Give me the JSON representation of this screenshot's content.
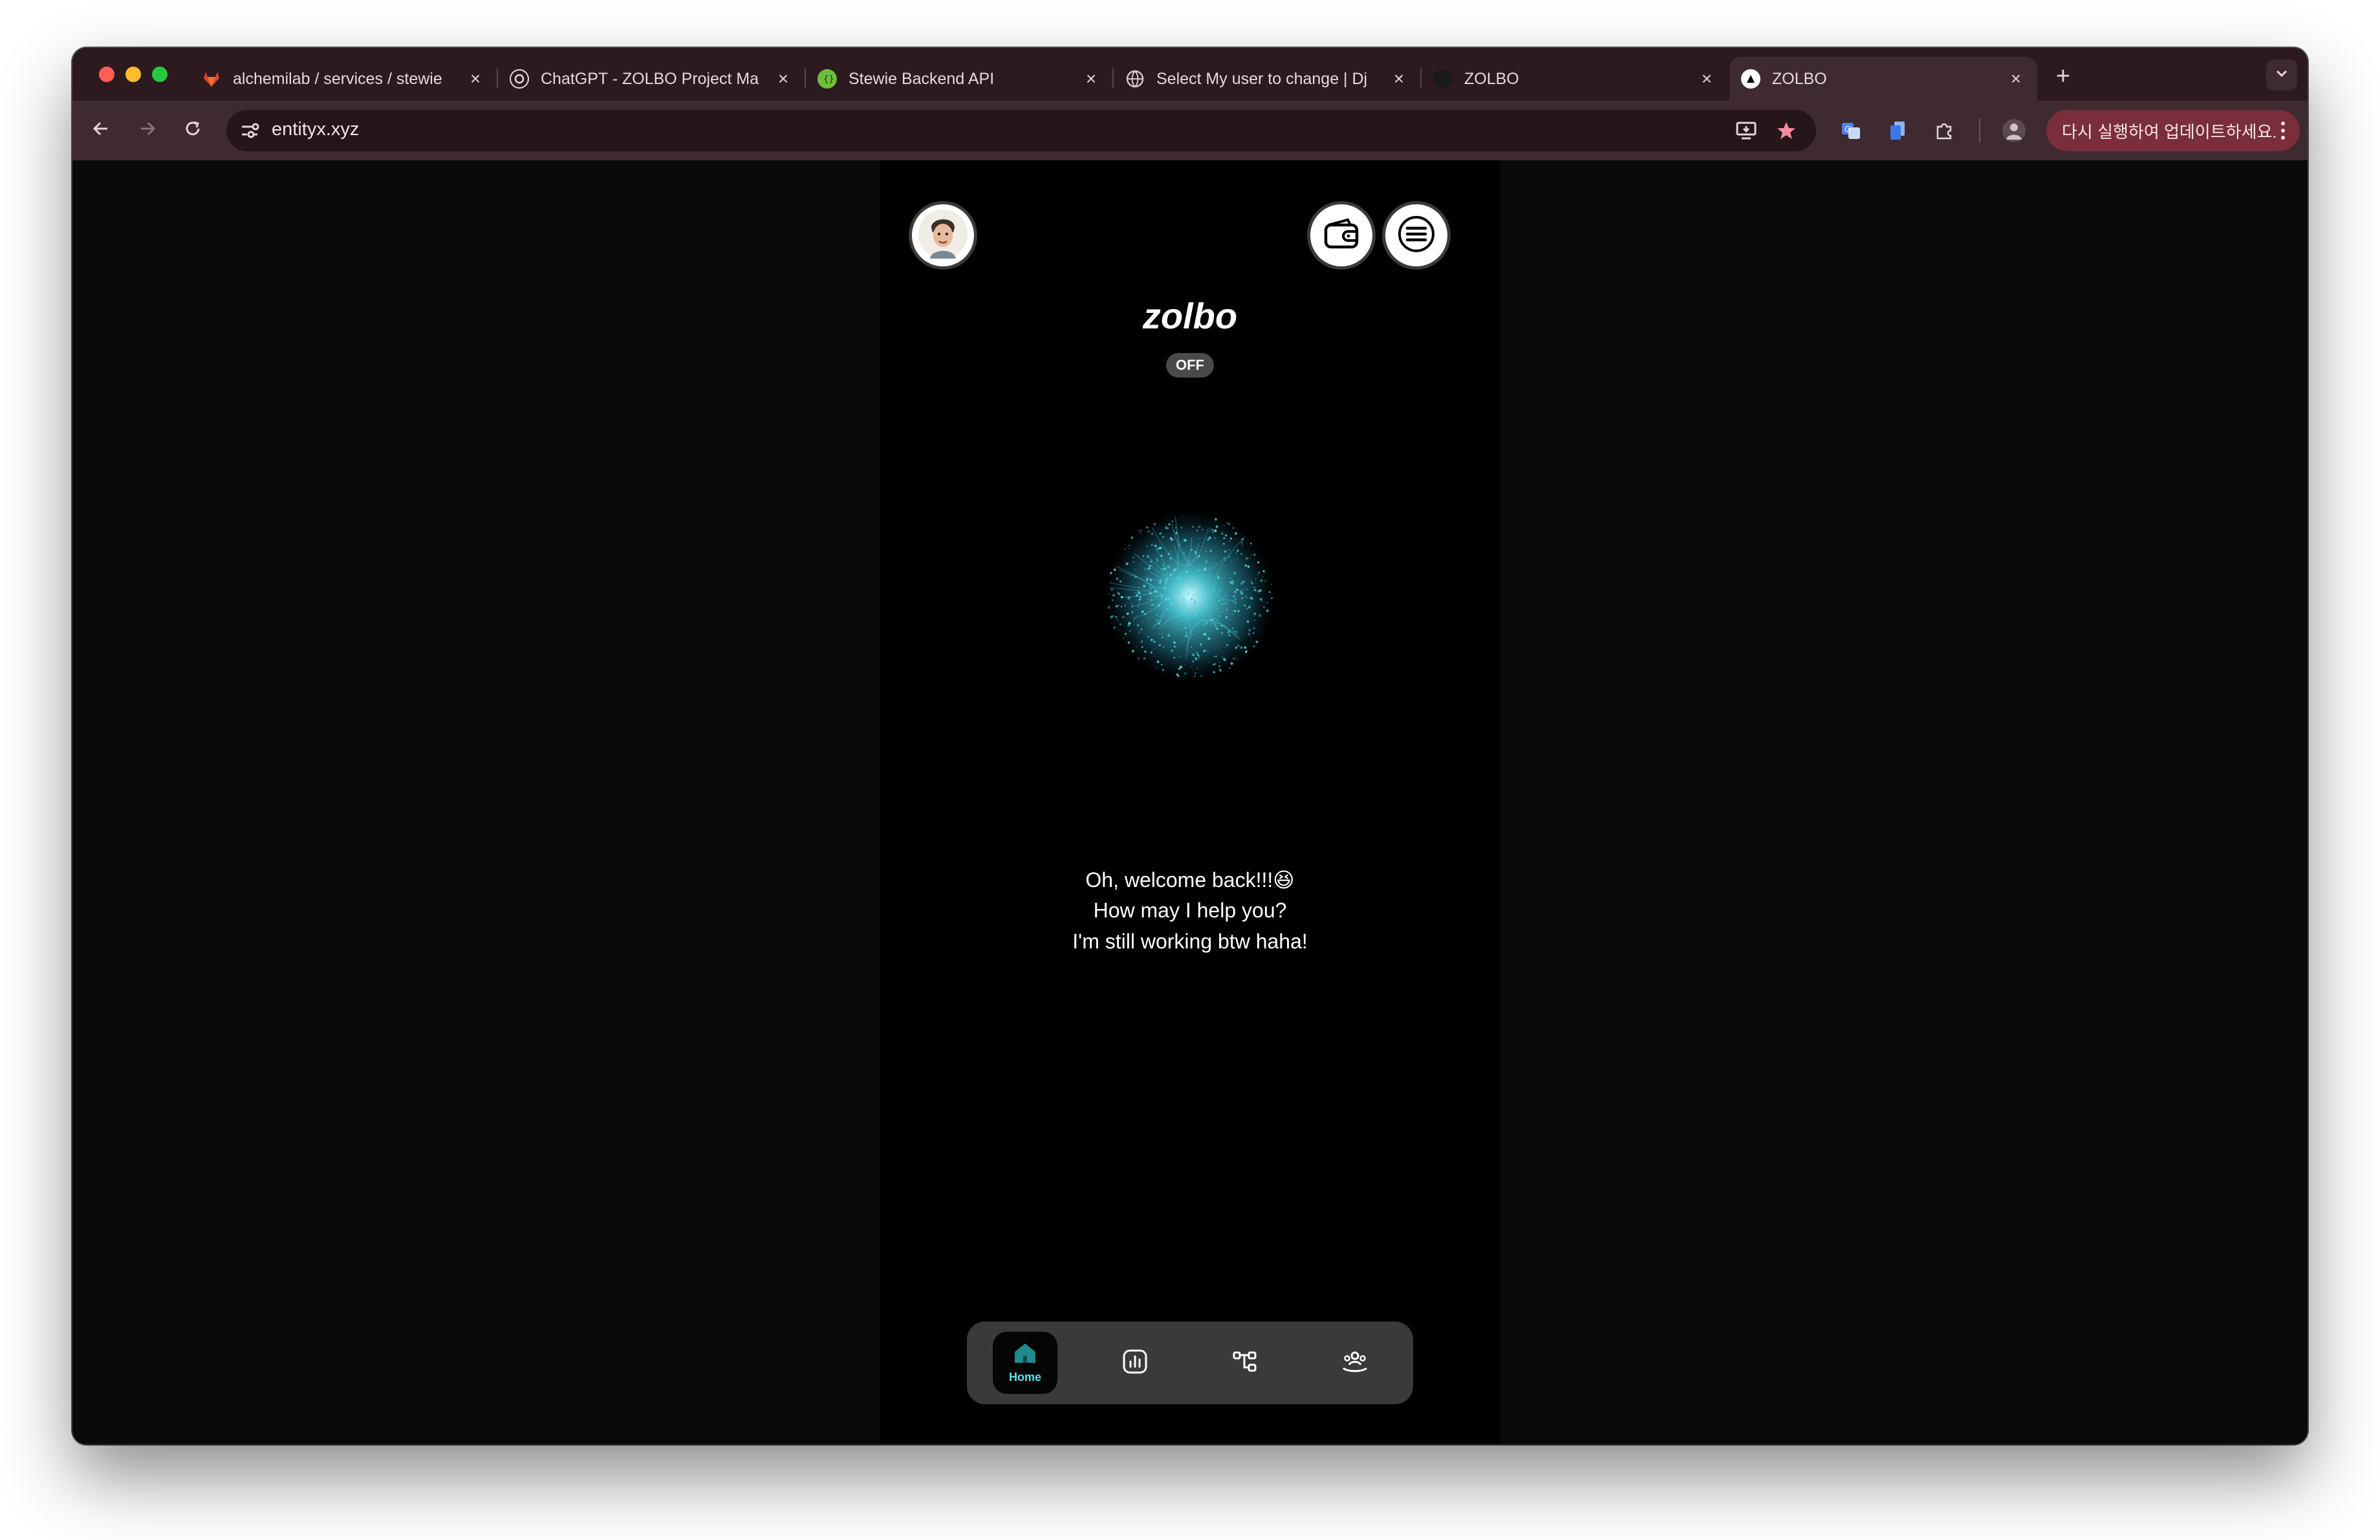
{
  "browser": {
    "tabs": [
      {
        "title": "alchemilab / services / stewie",
        "icon": "gitlab-icon",
        "active": false
      },
      {
        "title": "ChatGPT - ZOLBO Project Ma",
        "icon": "openai-icon",
        "active": false
      },
      {
        "title": "Stewie Backend API",
        "icon": "api-docs-icon",
        "active": false
      },
      {
        "title": "Select My user to change | Dj",
        "icon": "globe-icon",
        "active": false
      },
      {
        "title": "ZOLBO",
        "icon": "blank-icon",
        "active": false
      },
      {
        "title": "ZOLBO",
        "icon": "zolbo-triangle-icon",
        "active": true
      }
    ],
    "tab_close_glyph": "×",
    "new_tab_glyph": "+",
    "url": "entityx.xyz",
    "update_button": "다시 실행하여 업데이트하세요.",
    "accent_color": "#7a2d3a"
  },
  "app": {
    "brand": "zolbo",
    "status_badge": "OFF",
    "message_lines": [
      "Oh, welcome back!!!😆",
      "How may I help you?",
      "I'm still working btw haha!"
    ],
    "orb_color": "#4fd8e8",
    "nav": [
      {
        "icon": "home-icon",
        "label": "Home",
        "active": true
      },
      {
        "icon": "chart-icon",
        "label": "",
        "active": false
      },
      {
        "icon": "flow-icon",
        "label": "",
        "active": false
      },
      {
        "icon": "community-icon",
        "label": "",
        "active": false
      }
    ]
  }
}
